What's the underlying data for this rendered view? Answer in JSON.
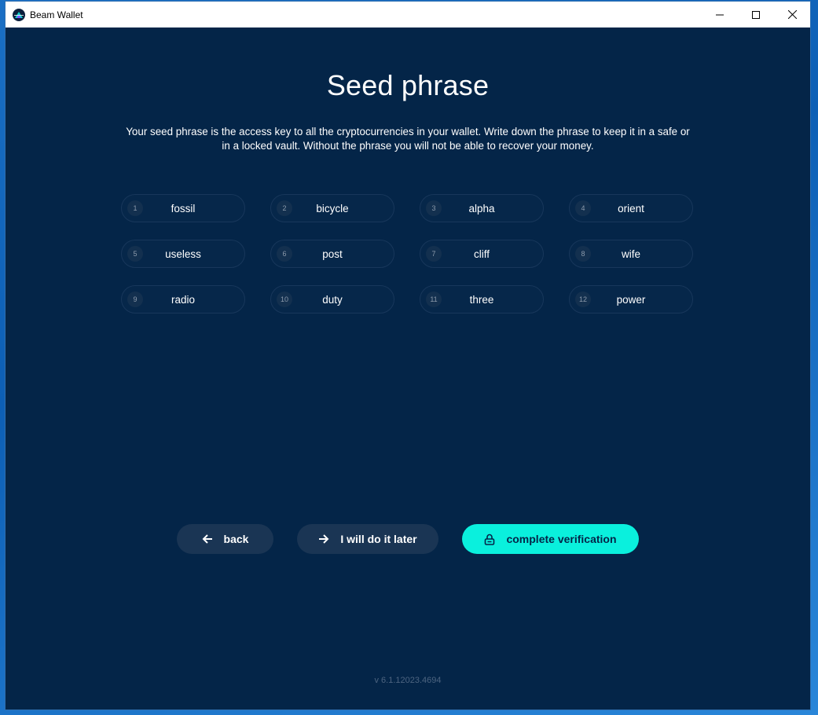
{
  "window": {
    "title": "Beam Wallet",
    "controls": {
      "minimize": "minimize-icon",
      "maximize": "maximize-icon",
      "close": "close-icon"
    }
  },
  "page": {
    "title": "Seed phrase",
    "description": "Your seed phrase is the access key to all the cryptocurrencies in your wallet. Write down the phrase to keep it in a safe or in a locked vault. Without the phrase you will not be able to recover your money."
  },
  "seed": [
    {
      "num": "1",
      "word": "fossil"
    },
    {
      "num": "2",
      "word": "bicycle"
    },
    {
      "num": "3",
      "word": "alpha"
    },
    {
      "num": "4",
      "word": "orient"
    },
    {
      "num": "5",
      "word": "useless"
    },
    {
      "num": "6",
      "word": "post"
    },
    {
      "num": "7",
      "word": "cliff"
    },
    {
      "num": "8",
      "word": "wife"
    },
    {
      "num": "9",
      "word": "radio"
    },
    {
      "num": "10",
      "word": "duty"
    },
    {
      "num": "11",
      "word": "three"
    },
    {
      "num": "12",
      "word": "power"
    }
  ],
  "buttons": {
    "back": {
      "label": "back",
      "icon": "arrow-left-icon"
    },
    "later": {
      "label": "I will do it later",
      "icon": "arrow-right-icon"
    },
    "complete": {
      "label": "complete verification",
      "icon": "lock-icon"
    }
  },
  "version": "v 6.1.12023.4694",
  "colors": {
    "background": "#042548",
    "accent": "#0af0dd",
    "secondary_button": "#1a3554",
    "seed_border": "#18375b"
  }
}
